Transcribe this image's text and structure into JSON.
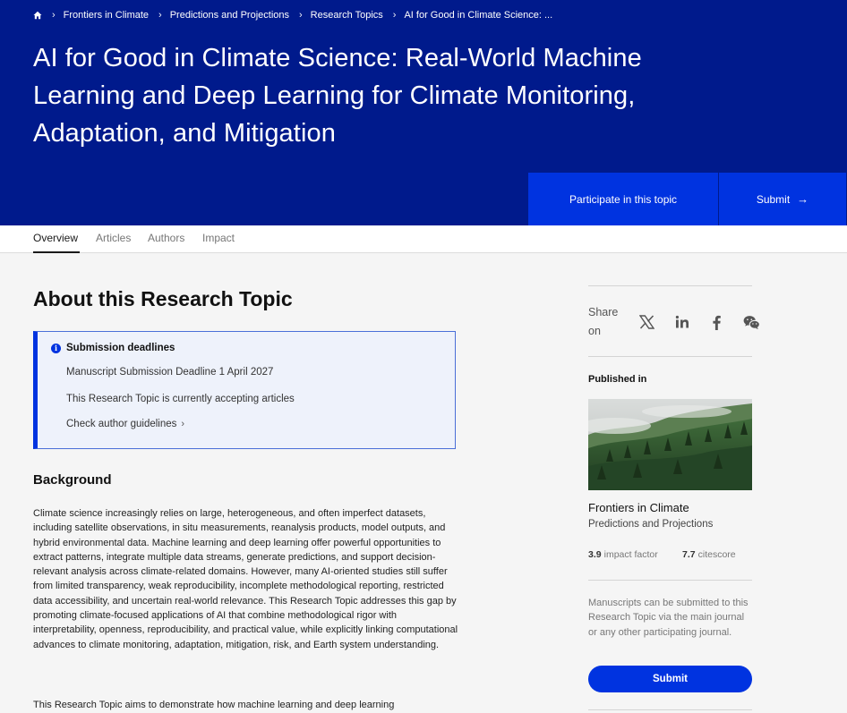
{
  "breadcrumb": {
    "items": [
      "Frontiers in Climate",
      "Predictions and Projections",
      "Research Topics",
      "AI for Good in Climate Science: ..."
    ]
  },
  "hero": {
    "title": "AI for Good in Climate Science: Real-World Machine Learning and Deep Learning for Climate Monitoring, Adaptation, and Mitigation",
    "participate_label": "Participate in this topic",
    "submit_label": "Submit",
    "submit_arrow": "→"
  },
  "tabs": [
    {
      "label": "Overview",
      "active": true
    },
    {
      "label": "Articles"
    },
    {
      "label": "Authors"
    },
    {
      "label": "Impact"
    }
  ],
  "main": {
    "about_title": "About this Research Topic",
    "deadlines": {
      "heading": "Submission deadlines",
      "manuscript": "Manuscript Submission Deadline 1 April 2027",
      "status": "This Research Topic is currently accepting articles",
      "guidelines_link": "Check author guidelines",
      "chevron": "›"
    },
    "background_title": "Background",
    "background_text": "Climate science increasingly relies on large, heterogeneous, and often imperfect datasets, including satellite observations, in situ measurements, reanalysis products, model outputs, and hybrid environmental data. Machine learning and deep learning offer powerful opportunities to extract patterns, integrate multiple data streams, generate predictions, and support decision-relevant analysis across climate-related domains. However, many AI-oriented studies still suffer from limited transparency, weak reproducibility, incomplete methodological reporting, restricted data accessibility, and uncertain real-world relevance. This Research Topic addresses this gap by promoting climate-focused applications of AI that combine methodological rigor with interpretability, openness, reproducibility, and practical value, while explicitly linking computational advances to climate monitoring, adaptation, mitigation, risk, and Earth system understanding.",
    "background_text_2": "This Research Topic aims to demonstrate how machine learning and deep learning"
  },
  "sidebar": {
    "share_label": "Share on",
    "social_icons": [
      "x-icon",
      "linkedin-icon",
      "facebook-icon",
      "wechat-icon"
    ],
    "published_in": "Published in",
    "journal_name": "Frontiers in Climate",
    "journal_section": "Predictions and Projections",
    "impact_factor_value": "3.9",
    "impact_factor_label": "impact factor",
    "citescore_value": "7.7",
    "citescore_label": "citescore",
    "note": "Manuscripts can be submitted to this Research Topic via the main journal or any other participating journal.",
    "submit_label": "Submit"
  },
  "colors": {
    "hero_bg": "#001a8c",
    "accent": "#0033e0",
    "page_bg": "#f5f5f5"
  }
}
